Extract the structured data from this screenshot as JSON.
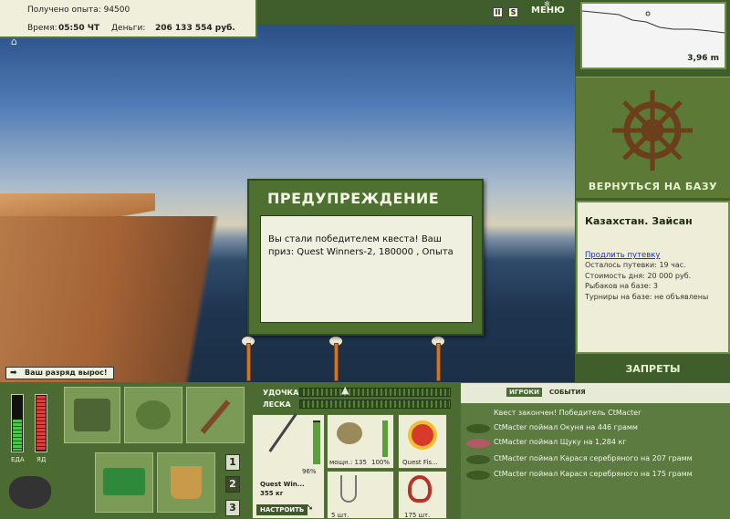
{
  "top": {
    "xp_label": "Получено опыта: 94500",
    "time_label": "Время:",
    "time_value": "05:50 ЧТ",
    "money_label": "Деньги:",
    "money_value": "206 133 554 руб."
  },
  "toolbar": {
    "pause": "II",
    "sound": "S",
    "menu": "МЕНЮ"
  },
  "depth": {
    "value": "3,96 m"
  },
  "base": {
    "return_label": "ВЕРНУТЬСЯ НА БАЗУ",
    "title": "Казахстан. Зайсан",
    "extend_link": "Продлить путевку",
    "lines": [
      "Осталось путевки: 19 час.",
      "Стоимость дня: 20 000 руб.",
      "Рыбаков на базе: 3",
      "Турниры на базе: не объявлены"
    ],
    "bans_label": "ЗАПРЕТЫ"
  },
  "scene": {
    "rank_badge": "Ваш разряд вырос!"
  },
  "dialog": {
    "title": "ПРЕДУПРЕЖДЕНИЕ",
    "message": "Вы стали победителем квеста! Ваш приз: Quest Winners-2, 180000 , Опыта"
  },
  "status": {
    "food_label": "ЕДА",
    "poison_label": "ЯД"
  },
  "tackle": {
    "rod_label": "УДОЧКА",
    "line_label": "ЛЕСКА",
    "rod_name": "Quest Win...",
    "rod_weight": "355 кг",
    "rod_percent": "96%",
    "configure_btn": "НАСТРОИТЬ",
    "reel_power": "мощн.: 135",
    "reel_percent": "100%",
    "line_name": "Quest Fis...",
    "hooks_count": "5 шт.",
    "bait_count": "175 шт."
  },
  "pages": [
    "1",
    "2",
    "3"
  ],
  "events": {
    "tabs": [
      "ИГРОКИ",
      "СОБЫТИЯ"
    ],
    "items": [
      "Квест закончен! Победитель CtMacter",
      "CtMacter поймал Окуня на 446 грамм",
      "CtMacter поймал Щуку на 1,284 кг",
      "CtMacter поймал Карася серебряного на 207 грамм",
      "CtMacter поймал Карася серебряного на 175 грамм"
    ]
  }
}
